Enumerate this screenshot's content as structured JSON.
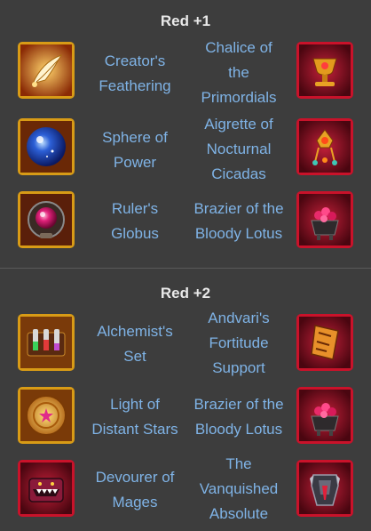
{
  "sections": [
    {
      "title": "Red +1",
      "rows": [
        {
          "left": {
            "icon": "winged-feather-icon",
            "lines": [
              "Creator's",
              "Feathering"
            ]
          },
          "right": {
            "icon": "chalice-icon",
            "lines": [
              "Chalice of",
              "the",
              "Primordials"
            ]
          }
        },
        {
          "left": {
            "icon": "power-sphere-icon",
            "lines": [
              "Sphere of",
              "Power"
            ]
          },
          "right": {
            "icon": "aigrette-icon",
            "lines": [
              "Aigrette of",
              "Nocturnal",
              "Cicadas"
            ]
          }
        },
        {
          "left": {
            "icon": "globus-icon",
            "lines": [
              "Ruler's",
              "Globus"
            ]
          },
          "right": {
            "icon": "lotus-brazier-icon",
            "lines": [
              "Brazier of the",
              "Bloody Lotus"
            ]
          }
        }
      ]
    },
    {
      "title": "Red +2",
      "rows": [
        {
          "left": {
            "icon": "alchemist-set-icon",
            "lines": [
              "Alchemist's",
              "Set"
            ]
          },
          "right": {
            "icon": "fortitude-support-icon",
            "lines": [
              "Andvari's",
              "Fortitude",
              "Support"
            ]
          }
        },
        {
          "left": {
            "icon": "star-medallion-icon",
            "lines": [
              "Light of",
              "Distant Stars"
            ]
          },
          "right": {
            "icon": "lotus-brazier-icon",
            "lines": [
              "Brazier of the",
              "Bloody Lotus"
            ]
          }
        },
        {
          "left": {
            "icon": "devourer-chest-icon",
            "lines": [
              "Devourer of",
              "Mages"
            ]
          },
          "right": {
            "icon": "absolute-armor-icon",
            "lines": [
              "The",
              "Vanquished",
              "Absolute"
            ]
          }
        }
      ]
    }
  ]
}
